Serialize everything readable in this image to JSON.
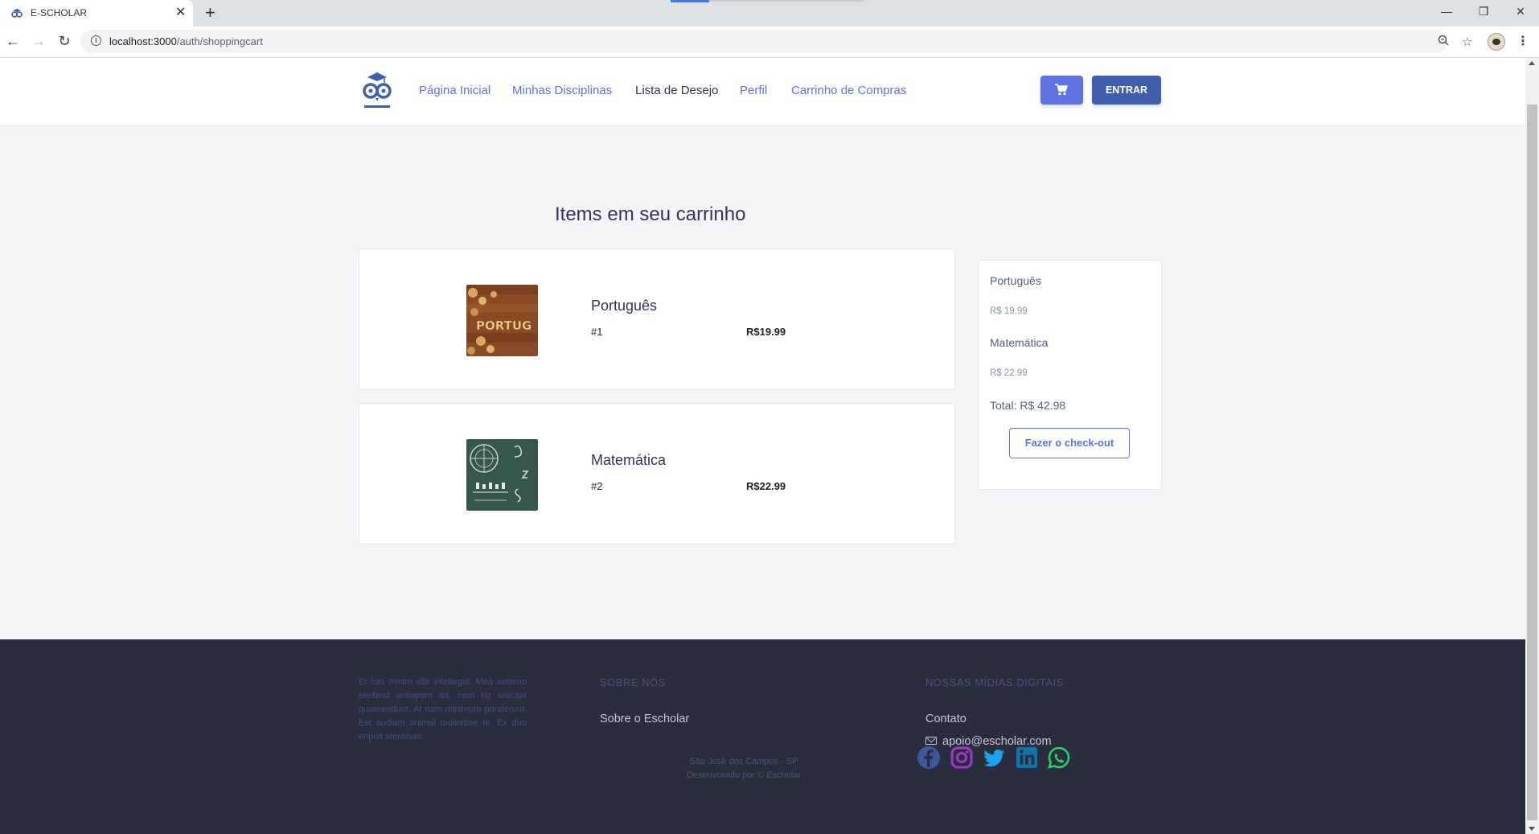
{
  "browser": {
    "tab_title": "E-SCHOLAR",
    "tab_close": "✕",
    "new_tab": "+",
    "url_host": "localhost:3000",
    "url_path": "/auth/shoppingcart",
    "window_minimize": "—",
    "window_restore": "❐",
    "window_close": "✕"
  },
  "header": {
    "nav": [
      {
        "label": "Página Inicial"
      },
      {
        "label": "Minhas Disciplinas"
      },
      {
        "label": "Lista de Desejo"
      },
      {
        "label": "Perfil"
      },
      {
        "label": "Carrinho de Compras"
      }
    ],
    "login_label": "ENTRAR",
    "accent": "#5e72e4",
    "login_color": "#3f5fae"
  },
  "main": {
    "heading": "Items em seu carrinho",
    "items": [
      {
        "name": "Português",
        "number": "#1",
        "price": "R$19.99",
        "thumb_text": "PORTUG"
      },
      {
        "name": "Matemática",
        "number": "#2",
        "price": "R$22.99"
      }
    ]
  },
  "summary": {
    "lines": [
      {
        "name": "Português",
        "price": "R$ 19.99"
      },
      {
        "name": "Matemática",
        "price": "R$ 22.99"
      }
    ],
    "total": "Total: R$ 42.98",
    "checkout_label": "Fazer o check-out"
  },
  "footer": {
    "lorem": "Et has minim elitr intellegat. Mea aeterno eleifend antiopam ad, nam no suscipit quaerendum. At nam minimum ponderum. Est audiam animal molestiae te. Ex duo eripuit mentitum.",
    "about_heading": "SOBRE NÓS",
    "about_link": "Sobre o Escholar",
    "media_heading": "NOSSAS MÍDIAS DIGITAIS",
    "contact": "Contato",
    "email": "apoio@escholar.com",
    "location": "São José dos Campos - SP",
    "credits": "Desenvolvido por © Escholar"
  }
}
